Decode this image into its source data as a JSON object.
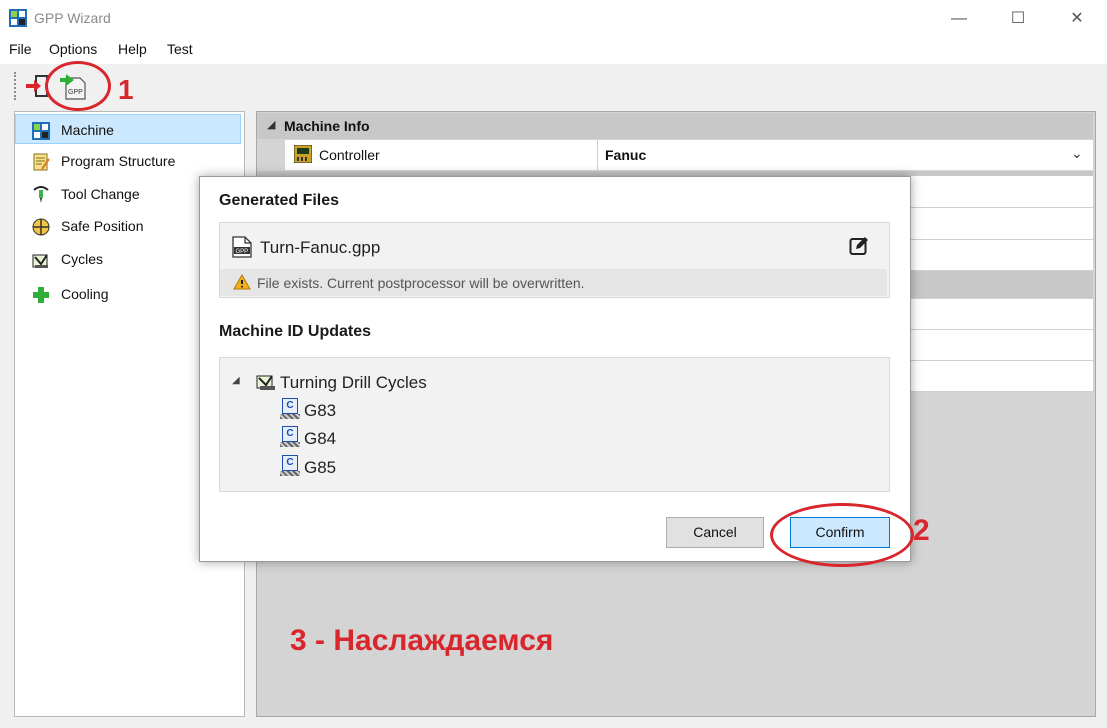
{
  "window": {
    "title": "GPP Wizard",
    "minimize": "—",
    "maximize": "☐",
    "close": "✕"
  },
  "menu": [
    "File",
    "Options",
    "Help",
    "Test"
  ],
  "nav": {
    "items": [
      {
        "label": "Machine",
        "icon": "machine-icon",
        "selected": true
      },
      {
        "label": "Program Structure",
        "icon": "program-structure-icon",
        "selected": false
      },
      {
        "label": "Tool Change",
        "icon": "tool-change-icon",
        "selected": false
      },
      {
        "label": "Safe Position",
        "icon": "safe-position-icon",
        "selected": false
      },
      {
        "label": "Cycles",
        "icon": "cycles-icon",
        "selected": false
      },
      {
        "label": "Cooling",
        "icon": "cooling-icon",
        "selected": false
      }
    ]
  },
  "panel": {
    "group": "Machine Info",
    "controller_label": "Controller",
    "controller_value": "Fanuc"
  },
  "dialog": {
    "generated_title": "Generated Files",
    "file_name": "Turn-Fanuc.gpp",
    "file_icon_text": "GPP",
    "warning": "File exists. Current postprocessor will be overwritten.",
    "machine_id_title": "Machine ID Updates",
    "tree_parent": "Turning Drill Cycles",
    "tree_children": [
      "G83",
      "G84",
      "G85"
    ],
    "cycle_badge": "C",
    "cancel": "Cancel",
    "confirm": "Confirm"
  },
  "annotations": {
    "one": "1",
    "two": "2",
    "three": "3 - Наслаждаемся"
  },
  "colors": {
    "accent": "#0078d7",
    "annotation": "#d9262c",
    "selection": "#cce8ff"
  }
}
